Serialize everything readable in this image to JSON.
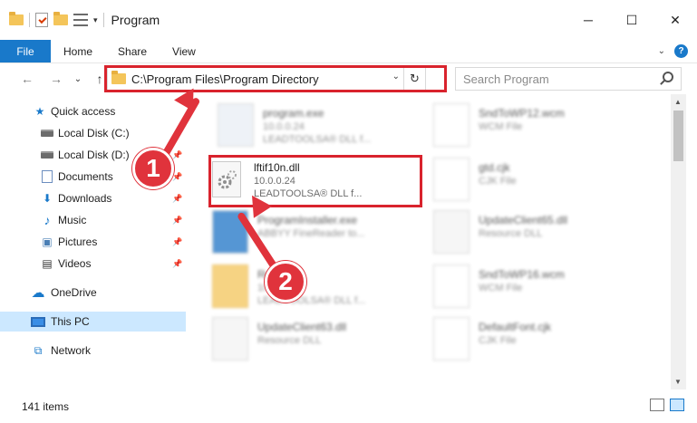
{
  "window": {
    "title": "Program",
    "min": "─",
    "max": "☐",
    "close": "✕"
  },
  "ribbon": {
    "file": "File",
    "tabs": [
      "Home",
      "Share",
      "View"
    ],
    "expand": "⌄",
    "help": "?"
  },
  "nav": {
    "back": "←",
    "forward": "→",
    "recent": "⌄",
    "up": "↑",
    "address": "C:\\Program Files\\Program Directory",
    "address_dd": "⌄",
    "refresh": "↻",
    "search_placeholder": "Search Program"
  },
  "sidebar": {
    "items": [
      {
        "label": "Quick access",
        "icon": "star-icon",
        "glyph": "★",
        "pinned": false
      },
      {
        "label": "Local Disk (C:)",
        "icon": "drive-icon",
        "pinned": true
      },
      {
        "label": "Local Disk (D:)",
        "icon": "drive-icon",
        "pinned": true
      },
      {
        "label": "Documents",
        "icon": "documents-icon",
        "pinned": true
      },
      {
        "label": "Downloads",
        "icon": "downloads-icon",
        "glyph": "⬇",
        "pinned": true
      },
      {
        "label": "Music",
        "icon": "music-icon",
        "glyph": "♪",
        "pinned": true
      },
      {
        "label": "Pictures",
        "icon": "pictures-icon",
        "glyph": "▣",
        "pinned": true
      },
      {
        "label": "Videos",
        "icon": "videos-icon",
        "glyph": "▤",
        "pinned": true
      },
      {
        "label": "OneDrive",
        "icon": "cloud-icon",
        "glyph": "☁",
        "pinned": false
      },
      {
        "label": "This PC",
        "icon": "pc-icon",
        "pinned": false
      },
      {
        "label": "Network",
        "icon": "network-icon",
        "glyph": "⧉",
        "pinned": false
      }
    ],
    "pin_glyph": "📌"
  },
  "files": {
    "left": [
      {
        "name": "program.exe",
        "line1": "10.0.0.24",
        "line2": "LEADTOOLSA® DLL f..."
      },
      {
        "name": "lftif10n.dll",
        "line1": "10.0.0.24",
        "line2": "LEADTOOLSA® DLL f..."
      },
      {
        "name": "ProgramInstaller.exe",
        "line1": "ABBYY FineReader to...",
        "line2": ""
      },
      {
        "name": "Rox",
        "line1": "10.0",
        "line2": "LEADTOOLSA® DLL f..."
      },
      {
        "name": "UpdateClient63.dll",
        "line1": "Resource DLL",
        "line2": ""
      }
    ],
    "right": [
      {
        "name": "SndToWP12.wcm",
        "line1": "WCM File"
      },
      {
        "name": "gtd.cjk",
        "line1": "CJK File"
      },
      {
        "name": "UpdateClient65.dll",
        "line1": "Resource DLL"
      },
      {
        "name": "SndToWP16.wcm",
        "line1": "WCM File"
      },
      {
        "name": "DefaultFont.cjk",
        "line1": "CJK File"
      }
    ]
  },
  "callouts": [
    "1",
    "2"
  ],
  "scroll": {
    "up": "▲",
    "down": "▼"
  },
  "status": {
    "items": "141 items"
  },
  "colors": {
    "accent": "#1979ca",
    "callout": "#e0333c",
    "selection": "#cce8ff"
  }
}
